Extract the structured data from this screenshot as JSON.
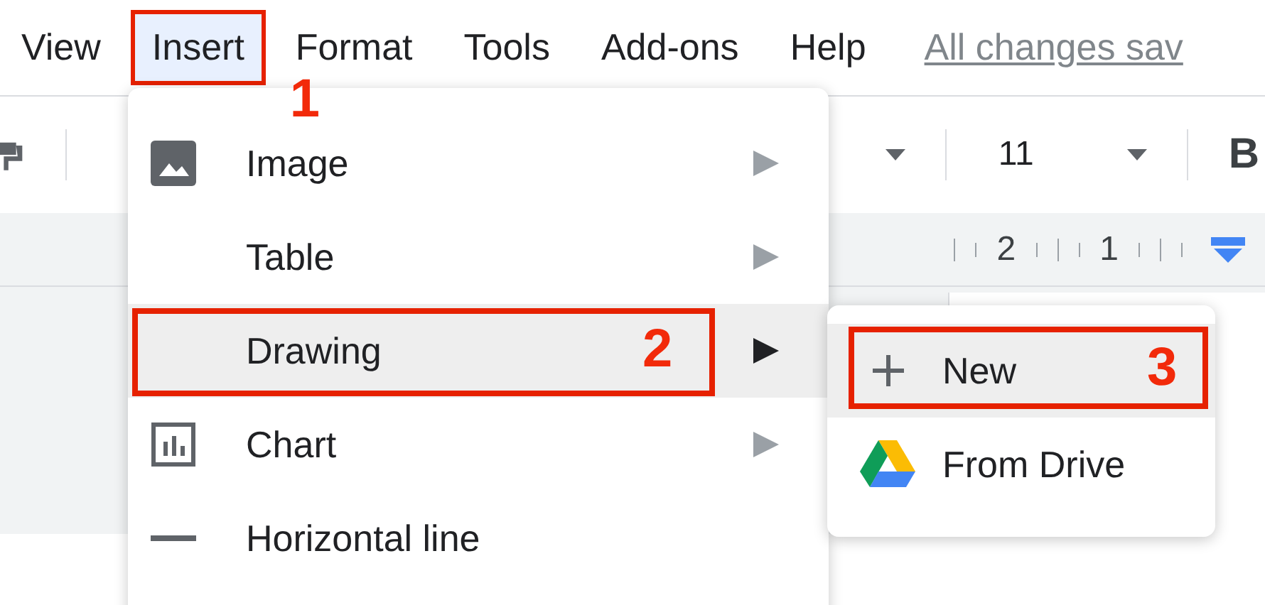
{
  "menu_bar": {
    "items": [
      {
        "label": "View",
        "selected": false
      },
      {
        "label": "Insert",
        "selected": true,
        "callout": "1"
      },
      {
        "label": "Format",
        "selected": false
      },
      {
        "label": "Tools",
        "selected": false
      },
      {
        "label": "Add-ons",
        "selected": false
      },
      {
        "label": "Help",
        "selected": false
      }
    ],
    "save_status": "All changes sav"
  },
  "toolbar": {
    "font_size": "11",
    "bold": "B"
  },
  "ruler": {
    "labels": [
      "2",
      "1"
    ]
  },
  "insert_menu": {
    "items": [
      {
        "label": "Image",
        "kind": "image",
        "submenu": true,
        "selected": false
      },
      {
        "label": "Table",
        "kind": "plain",
        "submenu": true,
        "selected": false
      },
      {
        "label": "Drawing",
        "kind": "plain",
        "submenu": true,
        "selected": true,
        "callout": "2"
      },
      {
        "label": "Chart",
        "kind": "chart",
        "submenu": true,
        "selected": false
      },
      {
        "label": "Horizontal line",
        "kind": "line",
        "submenu": false,
        "selected": false
      }
    ]
  },
  "drawing_submenu": {
    "items": [
      {
        "label": "New",
        "kind": "new",
        "selected": true,
        "callout": "3"
      },
      {
        "label": "From Drive",
        "kind": "drive",
        "selected": false
      }
    ]
  }
}
